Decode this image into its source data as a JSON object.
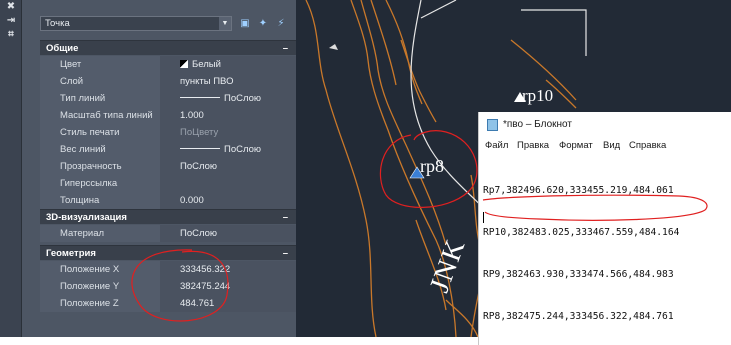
{
  "toolbar_strip": {
    "buttons": [
      "✖",
      "⇥",
      "⌗"
    ]
  },
  "properties": {
    "object_select": "Точка",
    "toolbar_icons": [
      "pickadd-icon",
      "select-objects-icon",
      "quick-select-icon"
    ],
    "sections": [
      {
        "title": "Общие",
        "collapse": "–",
        "rows": [
          {
            "key": "Цвет",
            "value": "Белый"
          },
          {
            "key": "Слой",
            "value": "пункты ПВО"
          },
          {
            "key": "Тип линий",
            "value": "ПоСлою"
          },
          {
            "key": "Масштаб типа линий",
            "value": "1.000"
          },
          {
            "key": "Стиль печати",
            "value": "ПоЦвету"
          },
          {
            "key": "Вес линий",
            "value": "ПоСлою"
          },
          {
            "key": "Прозрачность",
            "value": "ПоСлою"
          },
          {
            "key": "Гиперссылка",
            "value": ""
          },
          {
            "key": "Толщина",
            "value": "0.000"
          }
        ]
      },
      {
        "title": "3D-визуализация",
        "collapse": "–",
        "rows": [
          {
            "key": "Материал",
            "value": "ПоСлою"
          }
        ]
      },
      {
        "title": "Геометрия",
        "collapse": "–",
        "rows": [
          {
            "key": "Положение X",
            "value": "333456.322"
          },
          {
            "key": "Положение Y",
            "value": "382475.244"
          },
          {
            "key": "Положение Z",
            "value": "484.761"
          }
        ]
      }
    ]
  },
  "drawing": {
    "labels": {
      "rp10": "rp10",
      "rp8": "rp8",
      "side_text": "JNK"
    },
    "colors": {
      "background": "#222a36",
      "contour": "#c9782a",
      "boundary": "#e6e6e6",
      "marker": "#3a7fd6",
      "annotation": "#e02020"
    }
  },
  "notepad": {
    "title": "*пво – Блокнот",
    "menu": [
      "Файл",
      "Правка",
      "Формат",
      "Вид",
      "Справка"
    ],
    "lines": [
      "Rp7,382496.620,333455.219,484.061",
      "RP10,382483.025,333467.559,484.164",
      "RP9,382463.930,333474.566,484.983",
      "RP8,382475.244,333456.322,484.761"
    ]
  }
}
